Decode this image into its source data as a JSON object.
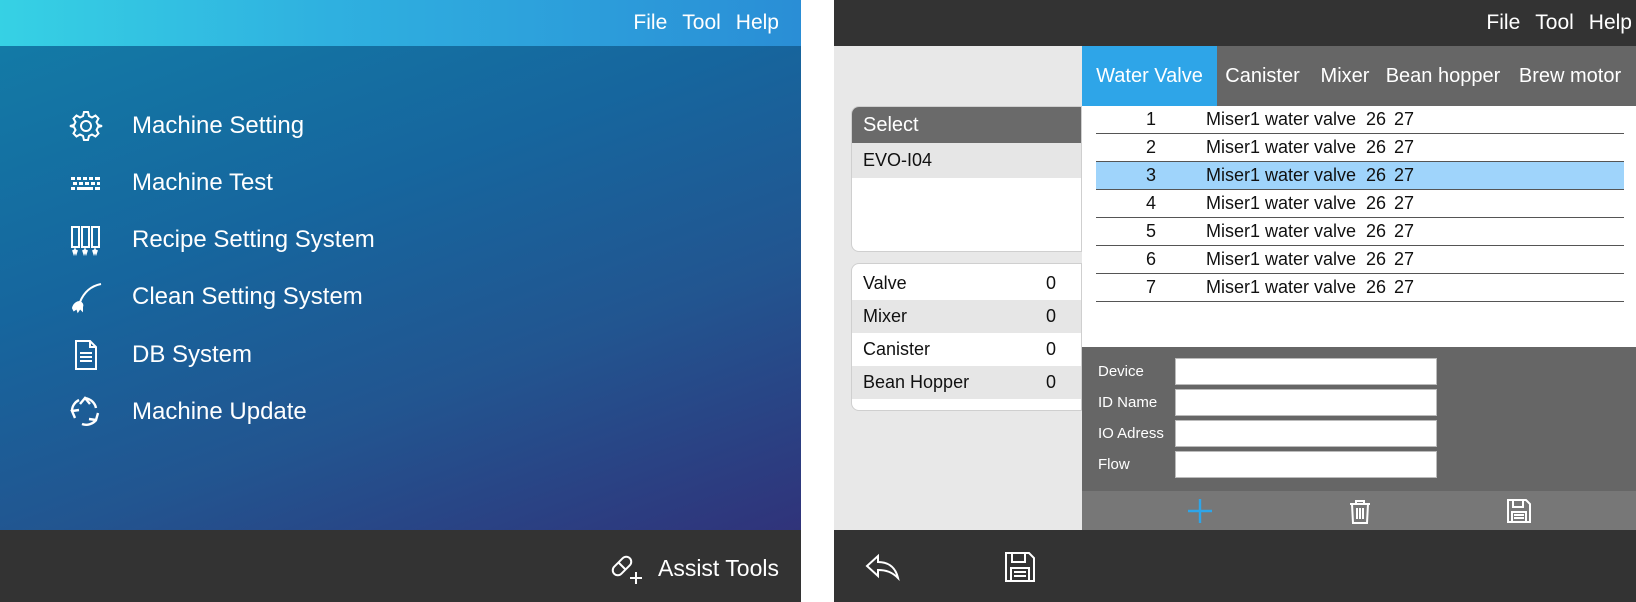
{
  "left": {
    "menu": [
      "File",
      "Tool",
      "Help"
    ],
    "nav": [
      {
        "label": "Machine Setting",
        "icon": "gear-icon"
      },
      {
        "label": "Machine Test",
        "icon": "keyboard-icon"
      },
      {
        "label": "Recipe Setting System",
        "icon": "cylinders-icon"
      },
      {
        "label": "Clean Setting System",
        "icon": "brush-icon"
      },
      {
        "label": "DB System",
        "icon": "document-icon"
      },
      {
        "label": "Machine Update",
        "icon": "recycle-icon"
      }
    ],
    "assist_label": "Assist Tools",
    "assist_icon": "pill-add-icon"
  },
  "right": {
    "menu": [
      "File",
      "Tool",
      "Help"
    ],
    "tabs": [
      {
        "label": "Water Valve",
        "active": true
      },
      {
        "label": "Canister",
        "active": false
      },
      {
        "label": "Mixer",
        "active": false
      },
      {
        "label": "Bean hopper",
        "active": false
      },
      {
        "label": "Brew motor",
        "active": false
      }
    ],
    "select": {
      "header": "Select",
      "option": "EVO-I04"
    },
    "counts": [
      {
        "label": "Valve",
        "value": "0"
      },
      {
        "label": "Mixer",
        "value": "0"
      },
      {
        "label": "Canister",
        "value": "0"
      },
      {
        "label": "Bean Hopper",
        "value": "0"
      }
    ],
    "rows": [
      {
        "id": "1",
        "name": "Miser1 water valve",
        "a": "26",
        "b": "27",
        "selected": false
      },
      {
        "id": "2",
        "name": "Miser1 water valve",
        "a": "26",
        "b": "27",
        "selected": false
      },
      {
        "id": "3",
        "name": "Miser1 water valve",
        "a": "26",
        "b": "27",
        "selected": true
      },
      {
        "id": "4",
        "name": "Miser1 water valve",
        "a": "26",
        "b": "27",
        "selected": false
      },
      {
        "id": "5",
        "name": "Miser1 water valve",
        "a": "26",
        "b": "27",
        "selected": false
      },
      {
        "id": "6",
        "name": "Miser1 water valve",
        "a": "26",
        "b": "27",
        "selected": false
      },
      {
        "id": "7",
        "name": "Miser1 water valve",
        "a": "26",
        "b": "27",
        "selected": false
      }
    ],
    "form": {
      "device_label": "Device",
      "device_value": "",
      "idname_label": "ID Name",
      "idname_value": "",
      "ioaddr_label": "IO Adress",
      "ioaddr_value": "",
      "flow_label": "Flow",
      "flow_value": ""
    },
    "colors": {
      "accent": "#2ea5e8",
      "selected_row": "#9fd4fb",
      "dark": "#333333"
    }
  }
}
